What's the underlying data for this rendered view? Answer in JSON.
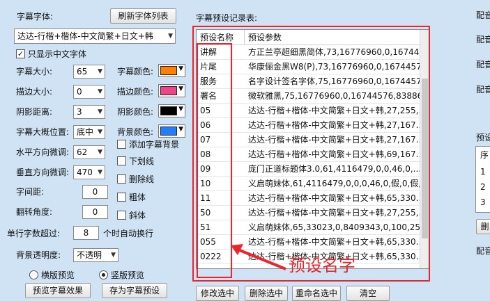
{
  "font_section": {
    "title": "字幕字体:",
    "refresh_label": "刷新字体列表",
    "font_value": "达达-行楷+楷体-中文简繁+日文+韩",
    "only_chinese_label": "只显示中文字体",
    "only_chinese_checked": "✓"
  },
  "settings": {
    "size_label": "字幕大小:",
    "size_value": "65",
    "stroke_label": "描边大小:",
    "stroke_value": "0",
    "shadow_label": "阴影距离:",
    "shadow_value": "3",
    "position_label": "字幕大概位置:",
    "position_value": "底中",
    "hfine_label": "水平方向微调:",
    "hfine_value": "62",
    "vfine_label": "垂直方向微调:",
    "vfine_value": "470",
    "spacing_label": "字间距:",
    "spacing_value": "0",
    "flip_label": "翻转角度:",
    "flip_value": "0",
    "wrap_prefix": "单行字数超过:",
    "wrap_value": "8",
    "wrap_suffix": "个时自动换行",
    "bg_opacity_label": "背景透明度:",
    "bg_opacity_value": "不透明"
  },
  "colors": {
    "subtitle_label": "字幕颜色:",
    "subtitle_color": "#ff7f00",
    "stroke_label": "描边颜色:",
    "stroke_color": "#ee4488",
    "shadow_label": "阴影颜色:",
    "shadow_color": "#000000",
    "bg_label": "背景颜色:",
    "bg_color": "#1f7fff"
  },
  "options": {
    "add_bg": "添加字幕背景",
    "underline": "下划线",
    "strikethrough": "删除线",
    "bold": "粗体",
    "italic": "斜体"
  },
  "preview_mode": {
    "horizontal": "横版预览",
    "vertical": "竖版预览"
  },
  "bottom_buttons": {
    "b1": "预览字幕效果",
    "b2": "存为字幕预设",
    "b3": "修改选中",
    "b4": "删除选中",
    "b5": "重命名选中",
    "b6": "清空"
  },
  "preset_table": {
    "title": "字幕预设记录表:",
    "headers": [
      "预设名称",
      "预设参数"
    ],
    "rows": [
      {
        "name": "讲解",
        "params": "方正兰亭超细黑简体,73,16776960,0,167445..."
      },
      {
        "name": "片尾",
        "params": "华康俪金黑W8(P),73,16776960,0,16744576..."
      },
      {
        "name": "服务",
        "params": "名字设计签名字体,75,16776960,0,16744576..."
      },
      {
        "name": "署名",
        "params": "微软雅黑,75,16776960,0,16744576,838860..."
      },
      {
        "name": "05",
        "params": "达达-行楷+楷体-中文简繁+日文+韩,27,255,..."
      },
      {
        "name": "06",
        "params": "达达-行楷+楷体-中文简繁+日文+韩,27,167..."
      },
      {
        "name": "07",
        "params": "达达-行楷+楷体-中文简繁+日文+韩,27,167..."
      },
      {
        "name": "08",
        "params": "达达-行楷+楷体-中文简繁+日文+韩,69,167..."
      },
      {
        "name": "09",
        "params": "庞门正道标题体3.0,61,4116479,0,0,46,0,..."
      },
      {
        "name": "10",
        "params": "义启萌妹体,61,4116479,0,0,0,46,0,假,0,假,..."
      },
      {
        "name": "11",
        "params": "达达-行楷+楷体-中文简繁+日文+韩,65,330..."
      },
      {
        "name": "50",
        "params": "达达-行楷+楷体-中文简繁+日文+韩,27,255,..."
      },
      {
        "name": "51",
        "params": "义启萌妹体,65,33023,0,8409343,0,100,25,..."
      },
      {
        "name": "055",
        "params": "达达-行楷+楷体-中文简繁+日文+韩,65,330..."
      },
      {
        "name": "0222",
        "params": "达达-行楷+楷体-中文简繁+日文+韩,65,330..."
      }
    ]
  },
  "annotation": {
    "text": "预设名字",
    "color": "#e8262b"
  },
  "right_panel": {
    "l1": "配音",
    "l2": "配音",
    "l3": "配音",
    "l4": "配音",
    "preset": "预设",
    "seq": "序",
    "r1": "1",
    "r2": "2",
    "r3": "3",
    "del": "删",
    "l5": "配音"
  }
}
